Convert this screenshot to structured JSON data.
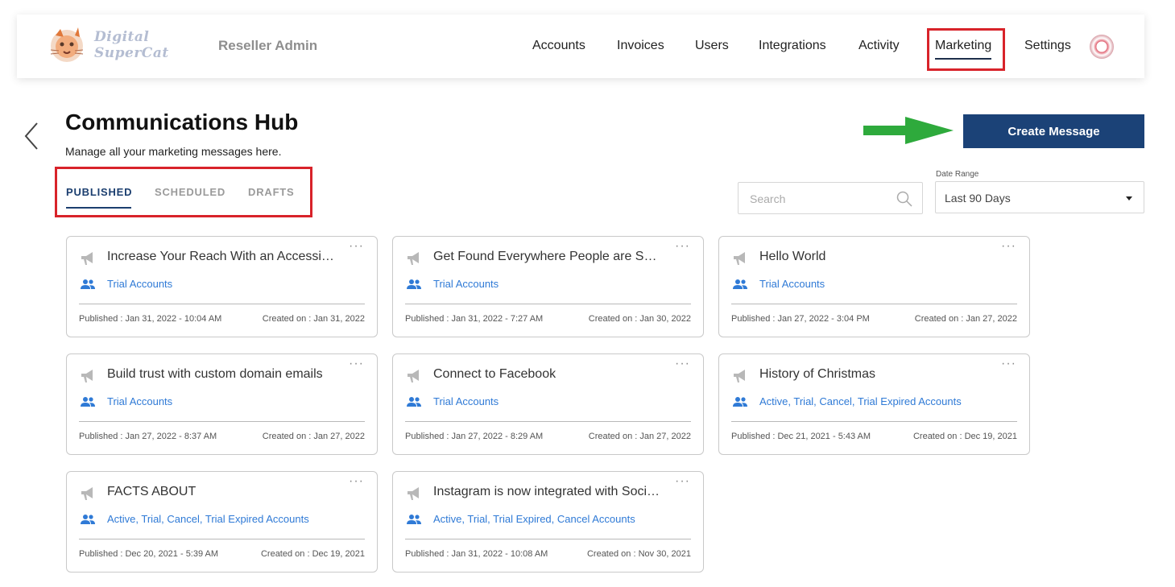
{
  "header": {
    "logo_text": "Digital SuperCat",
    "app_label": "Reseller Admin",
    "nav": [
      {
        "label": "Accounts"
      },
      {
        "label": "Invoices"
      },
      {
        "label": "Users"
      },
      {
        "label": "Integrations"
      },
      {
        "label": "Activity"
      },
      {
        "label": "Marketing",
        "active": true
      },
      {
        "label": "Settings"
      }
    ],
    "avatar_icon": "user-avatar-icon"
  },
  "page": {
    "title": "Communications Hub",
    "subtitle": "Manage all your marketing messages here.",
    "create_button": "Create Message",
    "tabs": [
      {
        "label": "PUBLISHED",
        "active": true
      },
      {
        "label": "SCHEDULED"
      },
      {
        "label": "DRAFTS"
      }
    ],
    "search_placeholder": "Search",
    "date_range_label": "Date Range",
    "date_range_value": "Last 90 Days"
  },
  "colors": {
    "primary": "#1b4277",
    "link": "#2f7ad6",
    "highlight_box": "#d8232a",
    "arrow": "#2eaa3c"
  },
  "cards": [
    {
      "more": "···",
      "title": "Increase Your Reach With an Accessibility...",
      "audience": "Trial Accounts",
      "published": "Published : Jan 31, 2022 - 10:04 AM",
      "created": "Created on : Jan 31, 2022"
    },
    {
      "more": "···",
      "title": "Get Found Everywhere People are Searching",
      "audience": "Trial Accounts",
      "published": "Published : Jan 31, 2022 - 7:27 AM",
      "created": "Created on : Jan 30, 2022"
    },
    {
      "more": "···",
      "title": "Hello World",
      "audience": "Trial Accounts",
      "published": "Published : Jan 27, 2022 - 3:04 PM",
      "created": "Created on : Jan 27, 2022"
    },
    {
      "more": "···",
      "title": "Build trust with custom domain emails",
      "audience": "Trial Accounts",
      "published": "Published : Jan 27, 2022 - 8:37 AM",
      "created": "Created on : Jan 27, 2022"
    },
    {
      "more": "···",
      "title": "Connect to Facebook",
      "audience": "Trial Accounts",
      "published": "Published : Jan 27, 2022 - 8:29 AM",
      "created": "Created on : Jan 27, 2022"
    },
    {
      "more": "···",
      "title": "History of Christmas",
      "audience": "Active, Trial, Cancel, Trial Expired Accounts",
      "published": "Published : Dec 21, 2021 - 5:43 AM",
      "created": "Created on : Dec 19, 2021"
    },
    {
      "more": "···",
      "title": "FACTS ABOUT",
      "audience": "Active, Trial, Cancel, Trial Expired Accounts",
      "published": "Published : Dec 20, 2021 - 5:39 AM",
      "created": "Created on : Dec 19, 2021"
    },
    {
      "more": "···",
      "title": "Instagram is now integrated with Social...",
      "audience": "Active, Trial, Trial Expired, Cancel Accounts",
      "published": "Published : Jan 31, 2022 - 10:08 AM",
      "created": "Created on : Nov 30, 2021"
    }
  ]
}
